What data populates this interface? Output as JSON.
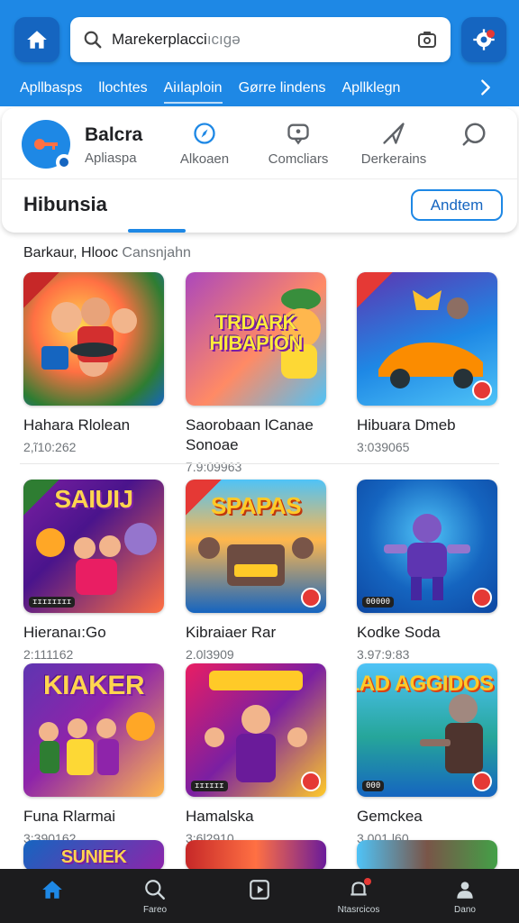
{
  "header": {
    "search_query": "Marekerplacci",
    "search_suffix": "ıcıgə",
    "tabs": [
      {
        "label": "Apllbasps"
      },
      {
        "label": "llochtes"
      },
      {
        "label": "Aiılaploin"
      },
      {
        "label": "Gørre  lindens"
      },
      {
        "label": "Apllklegn"
      }
    ]
  },
  "card": {
    "profile_title": "Balcra",
    "profile_subtitle": "Apliaspa",
    "categories": [
      {
        "label": "Alkoaen",
        "icon": "compass-icon"
      },
      {
        "label": "Comcliars",
        "icon": "chat-icon"
      },
      {
        "label": "Derkerains",
        "icon": "send-icon"
      },
      {
        "label": "",
        "icon": "comment-icon"
      }
    ],
    "section_title": "Hibunsia",
    "section_button": "Andtem"
  },
  "list": {
    "heading": "Barkaur, Hlooc",
    "heading_suffix": "Cansnjahn",
    "items": [
      {
        "name": "Hahara Rlolean",
        "number": "2,ĩ10:262",
        "art": "",
        "tag": ""
      },
      {
        "name": "Saorobaan lCanae",
        "name2": "Sonoae",
        "number": "7.9:09963",
        "art": "TRDARK HIBAPION",
        "tag": ""
      },
      {
        "name": "Hibuara Dmeb",
        "number": "3:039065",
        "art": "",
        "tag": ""
      },
      {
        "name": "Hieranaı:Go",
        "number": "2:111162",
        "art": "SAIUIJ",
        "tag": "ɪɪɪɪɪɪɪɪ"
      },
      {
        "name": "Kibraiaer Rar",
        "number": "2.0l3909",
        "art": "SPAPAS",
        "tag": ""
      },
      {
        "name": "Kodke Soda",
        "number": "3.97:9:83",
        "art": "",
        "tag": "00000"
      },
      {
        "name": "Funa Rlarmai",
        "number": "3:390162",
        "art": "KIAKER",
        "tag": ""
      },
      {
        "name": "Hamalska",
        "number": "3:6l2910",
        "art": "",
        "tag": "ɪɪɪɪɪɪ"
      },
      {
        "name": "Gemckea",
        "number": "3.001.l60",
        "art": "TLAD AGGIDOS",
        "tag": "000"
      },
      {
        "name": "",
        "number": "",
        "art": "SUNIEK",
        "tag": ""
      },
      {
        "name": "",
        "number": "",
        "art": "",
        "tag": ""
      },
      {
        "name": "",
        "number": "",
        "art": "",
        "tag": ""
      }
    ]
  },
  "bottom_nav": [
    {
      "label": "",
      "icon": "home-icon"
    },
    {
      "label": "Fareo",
      "icon": "search-icon"
    },
    {
      "label": "",
      "icon": "play-icon"
    },
    {
      "label": "Ntasrcicos",
      "icon": "bell-icon"
    },
    {
      "label": "Dano",
      "icon": "profile-icon"
    }
  ],
  "colors": {
    "primary": "#1e88e5",
    "primary_dark": "#1565c0",
    "notification": "#e53935",
    "nav_bg": "#1c1c1e"
  }
}
